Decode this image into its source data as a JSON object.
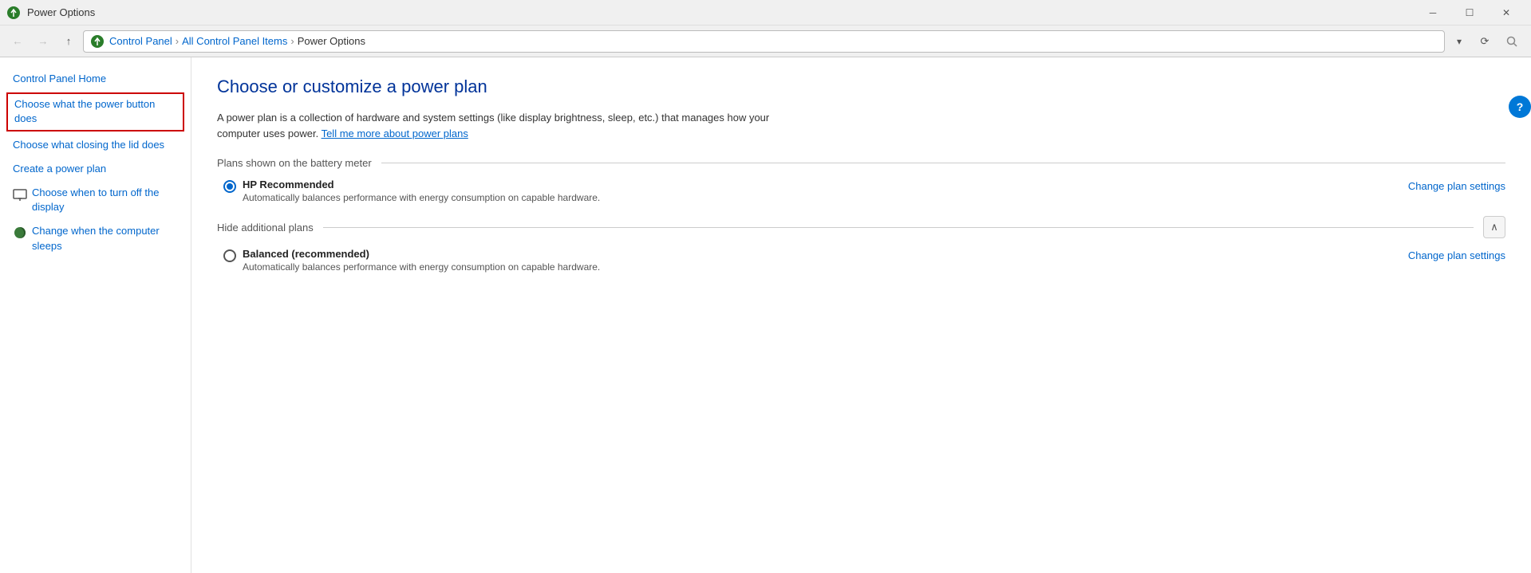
{
  "window": {
    "title": "Power Options",
    "icon": "⚡"
  },
  "titlebar": {
    "minimize_label": "─",
    "maximize_label": "☐",
    "close_label": "✕"
  },
  "addressbar": {
    "back_label": "←",
    "forward_label": "→",
    "up_label": "↑",
    "crumbs": [
      {
        "label": "Control Panel"
      },
      {
        "label": "All Control Panel Items"
      },
      {
        "label": "Power Options"
      }
    ],
    "dropdown_label": "▾",
    "refresh_label": "⟳",
    "search_placeholder": ""
  },
  "sidebar": {
    "home_label": "Control Panel Home",
    "items": [
      {
        "id": "power-button",
        "label": "Choose what the power button does",
        "active": true,
        "has_icon": false
      },
      {
        "id": "closing-lid",
        "label": "Choose what closing the lid does",
        "active": false,
        "has_icon": false
      },
      {
        "id": "create-plan",
        "label": "Create a power plan",
        "active": false,
        "has_icon": false
      },
      {
        "id": "turn-off-display",
        "label": "Choose when to turn off the display",
        "active": false,
        "has_icon": true
      },
      {
        "id": "computer-sleeps",
        "label": "Change when the computer sleeps",
        "active": false,
        "has_icon": true
      }
    ]
  },
  "main": {
    "title": "Choose or customize a power plan",
    "description1": "A power plan is a collection of hardware and system settings (like display brightness, sleep, etc.) that manages how your computer uses power.",
    "tell_me_link": "Tell me more about power plans",
    "battery_section_label": "Plans shown on the battery meter",
    "plans": [
      {
        "id": "hp-recommended",
        "name": "HP Recommended",
        "description": "Automatically balances performance with energy consumption on capable hardware.",
        "checked": true,
        "change_label": "Change plan settings"
      }
    ],
    "hide_plans_label": "Hide additional plans",
    "collapse_btn_label": "∧",
    "additional_plans": [
      {
        "id": "balanced",
        "name": "Balanced (recommended)",
        "description": "Automatically balances performance with energy consumption on capable hardware.",
        "checked": false,
        "change_label": "Change plan settings"
      }
    ]
  },
  "help": {
    "label": "?"
  }
}
